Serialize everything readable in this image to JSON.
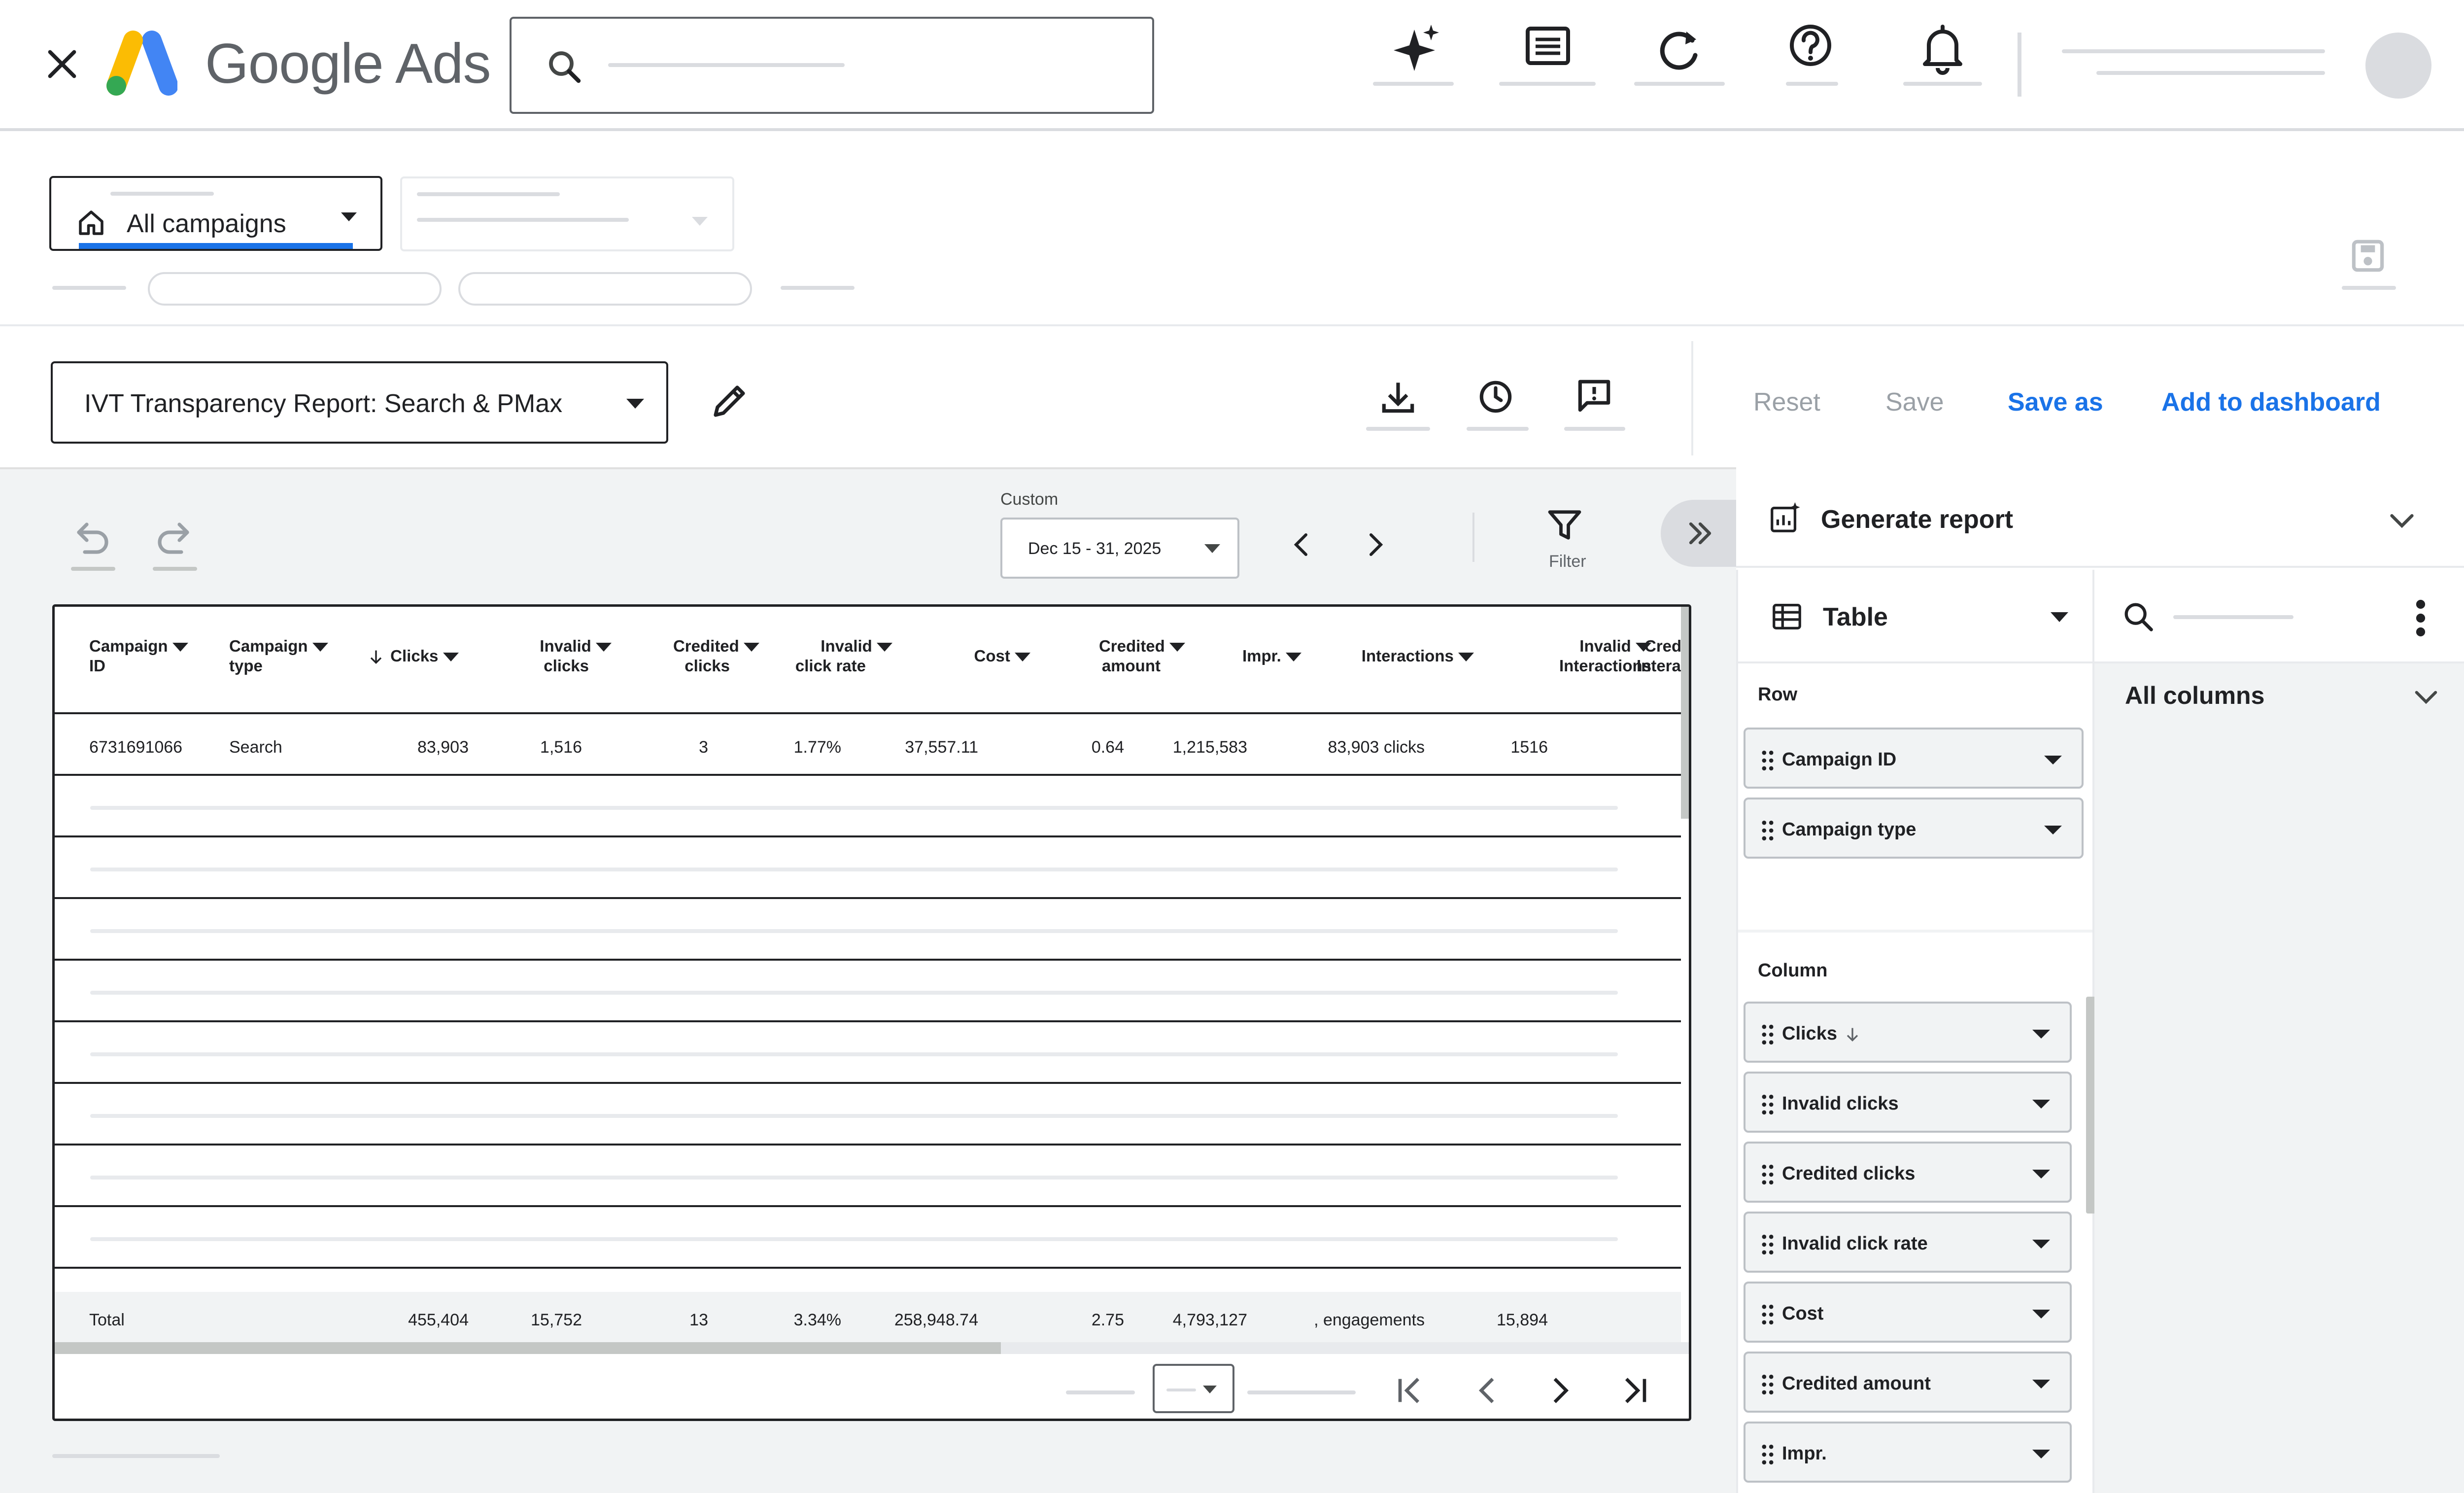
{
  "app": {
    "name_google": "Google",
    "name_ads": "Ads"
  },
  "campaign_filter": {
    "label": "All campaigns"
  },
  "report": {
    "title": "IVT Transparency Report: Search & PMax",
    "actions": {
      "reset": "Reset",
      "save": "Save",
      "save_as": "Save as",
      "add_to_dashboard": "Add to dashboard"
    }
  },
  "date": {
    "label": "Custom",
    "range": "Dec 15 - 31, 2025"
  },
  "filter_label": "Filter",
  "table": {
    "headers": [
      {
        "l1": "Campaign",
        "l2": "ID"
      },
      {
        "l1": "Campaign",
        "l2": "type"
      },
      {
        "l1": "Clicks",
        "l2": ""
      },
      {
        "l1": "Invalid",
        "l2": "clicks"
      },
      {
        "l1": "Credited",
        "l2": "clicks"
      },
      {
        "l1": "Invalid",
        "l2": "click rate"
      },
      {
        "l1": "Cost",
        "l2": ""
      },
      {
        "l1": "Credited",
        "l2": "amount"
      },
      {
        "l1": "Impr.",
        "l2": ""
      },
      {
        "l1": "Interactions",
        "l2": ""
      },
      {
        "l1": "Invalid",
        "l2": "Interactions"
      },
      {
        "l1": "Credited",
        "l2": "Interactions"
      }
    ],
    "row": [
      "6731691066",
      "Search",
      "83,903",
      "1,516",
      "3",
      "1.77%",
      "37,557.11",
      "0.64",
      "1,215,583",
      "83,903 clicks",
      "1516"
    ],
    "total": [
      "Total",
      "455,404",
      "15,752",
      "13",
      "3.34%",
      "258,948.74",
      "2.75",
      "4,793,127",
      ", engagements",
      "15,894"
    ]
  },
  "panel": {
    "generate_report": "Generate report",
    "viz_type": "Table",
    "row_section": "Row",
    "column_section": "Column",
    "all_columns": "All columns",
    "row_chips": [
      "Campaign ID",
      "Campaign type"
    ],
    "column_chips": [
      "Clicks",
      "Invalid clicks",
      "Credited clicks",
      "Invalid click rate",
      "Cost",
      "Credited amount",
      "Impr."
    ]
  },
  "colors": {
    "link_blue": "#1a73e8",
    "disabled_text": "#9aa0a6",
    "google_blue": "#4285f4",
    "google_yellow": "#fbbc04",
    "google_green": "#34a853"
  }
}
